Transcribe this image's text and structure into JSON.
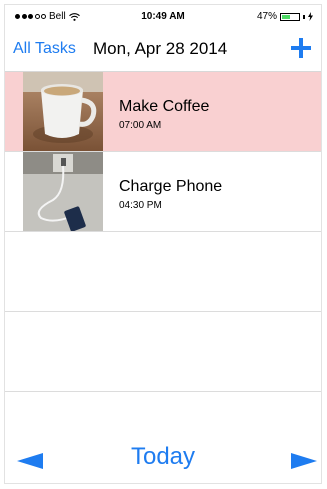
{
  "status_bar": {
    "carrier": "Bell",
    "time": "10:49 AM",
    "battery_percent_text": "47%",
    "battery_level": 0.47,
    "signal_bars_filled": 3,
    "signal_bars_total": 5
  },
  "nav": {
    "back_label": "All Tasks",
    "title": "Mon, Apr 28 2014",
    "add_icon": "plus-icon"
  },
  "tasks": [
    {
      "name": "Make Coffee",
      "time": "07:00 AM",
      "highlighted": true,
      "thumbnail": "coffee-cup-photo"
    },
    {
      "name": "Charge Phone",
      "time": "04:30 PM",
      "highlighted": false,
      "thumbnail": "phone-charger-photo"
    }
  ],
  "bottom_bar": {
    "prev_icon": "left-arrow-icon",
    "today_label": "Today",
    "next_icon": "right-arrow-icon"
  },
  "colors": {
    "accent": "#1e7cf0",
    "highlight_row": "#f9d0d1",
    "battery_fill": "#4cd964"
  }
}
